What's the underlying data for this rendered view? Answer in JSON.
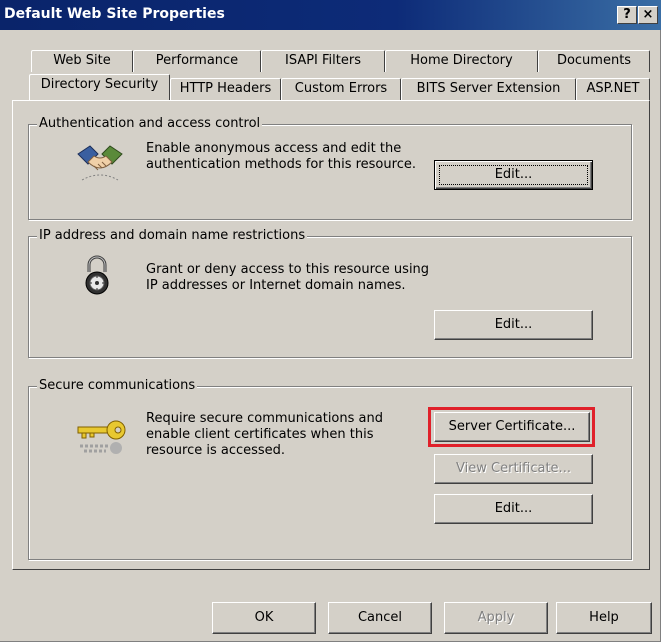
{
  "window": {
    "title": "Default Web Site Properties",
    "help_button": "?",
    "close_button": "×"
  },
  "tabs": {
    "row1": [
      "Web Site",
      "Performance",
      "ISAPI Filters",
      "Home Directory",
      "Documents"
    ],
    "row2": [
      "Directory Security",
      "HTTP Headers",
      "Custom Errors",
      "BITS Server Extension",
      "ASP.NET"
    ],
    "active": "Directory Security"
  },
  "auth": {
    "legend": "Authentication and access control",
    "line1": "Enable anonymous access and edit the",
    "line2": "authentication methods for this resource.",
    "edit_label": "Edit...",
    "icon": "handshake-icon"
  },
  "ip": {
    "legend": "IP address and domain name restrictions",
    "line1": "Grant or deny access to this resource using",
    "line2": "IP addresses or Internet domain names.",
    "edit_label": "Edit...",
    "icon": "padlock-icon"
  },
  "secure": {
    "legend": "Secure communications",
    "line1": "Require secure communications and",
    "line2": "enable client certificates when this",
    "line3": "resource is accessed.",
    "server_cert_label": "Server Certificate...",
    "view_cert_label": "View Certificate...",
    "edit_label": "Edit...",
    "icon": "key-icon",
    "highlight_color": "#e0202a"
  },
  "footer": {
    "ok": "OK",
    "cancel": "Cancel",
    "apply": "Apply",
    "help": "Help"
  }
}
